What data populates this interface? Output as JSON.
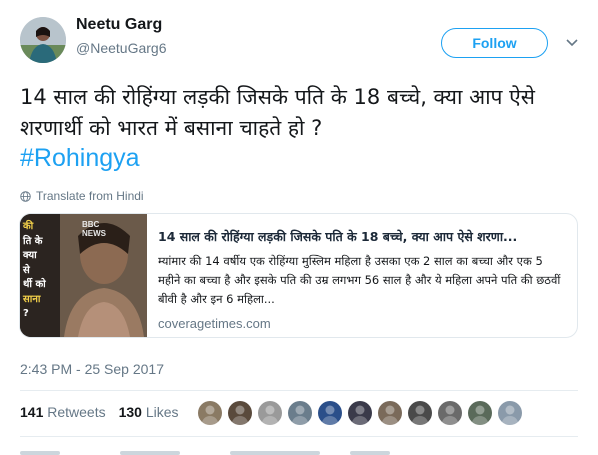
{
  "user": {
    "name": "Neetu Garg",
    "handle": "@NeetuGarg6",
    "follow_label": "Follow"
  },
  "tweet": {
    "text": "14 साल की रोहिंग्या लड़की जिसके पति के 18 बच्चे, क्या आप ऐसे शरणार्थी को भारत में बसाना चाहते हो ?",
    "hashtag": "#Rohingya",
    "translate_label": "Translate from Hindi"
  },
  "card": {
    "image_overlay_lines": [
      "की",
      "ति के",
      "क्या",
      "से",
      "र्थी को",
      "साना",
      "? "
    ],
    "image_badge": "BBC NEWS",
    "title": "14 साल की रोहिंग्या लड़की जिसके पति के 18 बच्चे, क्या आप ऐसे शरणा...",
    "description": "म्यांमार की 14 वर्षीय एक रोहिंग्या मुस्लिम महिला है उसका एक 2 साल का बच्चा और एक 5 महीने का बच्चा है और इसके पति की उम्र लगभग 56 साल है और ये महिला अपने पति की छठवीं बीवी है और इन 6 महिला...",
    "domain": "coveragetimes.com"
  },
  "timestamp": "2:43 PM - 25 Sep 2017",
  "stats": {
    "retweets_count": "141",
    "retweets_label": "Retweets",
    "likes_count": "130",
    "likes_label": "Likes"
  },
  "likers": [
    {
      "color": "#8a7a64"
    },
    {
      "color": "#5a4a3c"
    },
    {
      "color": "#9a9a9a"
    },
    {
      "color": "#6a7d8c"
    },
    {
      "color": "#2b4f8a"
    },
    {
      "color": "#3a3a4a"
    },
    {
      "color": "#7a6a5a"
    },
    {
      "color": "#4a4a4a"
    },
    {
      "color": "#6a6a6a"
    },
    {
      "color": "#5a6a5a"
    },
    {
      "color": "#8a9aaa"
    }
  ],
  "colors": {
    "accent": "#1da1f2",
    "text": "#14171a",
    "muted": "#657786"
  }
}
